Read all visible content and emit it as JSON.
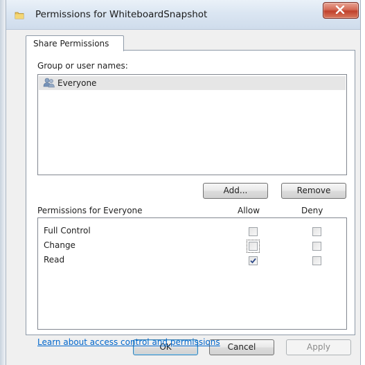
{
  "window": {
    "title": "Permissions for WhiteboardSnapshot",
    "close_icon": "close-x-icon",
    "title_icon": "folder-icon",
    "close_button_color": "#c9452f"
  },
  "tabs": [
    {
      "label": "Share Permissions",
      "selected": true
    }
  ],
  "group_section": {
    "label": "Group or user names:",
    "items": [
      {
        "name": "Everyone",
        "icon": "users-group-icon",
        "selected": true
      }
    ],
    "add_button": "Add...",
    "remove_button": "Remove"
  },
  "permissions_section": {
    "label": "Permissions for Everyone",
    "allow_header": "Allow",
    "deny_header": "Deny",
    "rows": [
      {
        "name": "Full Control",
        "allow": false,
        "deny": false
      },
      {
        "name": "Change",
        "allow": false,
        "deny": false
      },
      {
        "name": "Read",
        "allow": true,
        "deny": false
      }
    ]
  },
  "help_link": "Learn about access control and permissions",
  "buttons": {
    "ok": "OK",
    "cancel": "Cancel",
    "apply": "Apply"
  },
  "colors": {
    "link": "#0066cc",
    "selection": "#e6e6e6"
  }
}
